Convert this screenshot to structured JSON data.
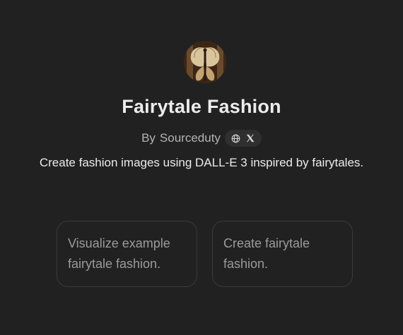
{
  "gpt": {
    "title": "Fairytale Fashion",
    "author_prefix": "By",
    "author": "Sourceduty",
    "description": "Create fashion images using DALL-E 3 inspired by fairytales.",
    "avatar_icon": "butterfly-dress-avatar",
    "social_icons": [
      "globe-icon",
      "x-logo-icon"
    ]
  },
  "conversation_starters": [
    {
      "label": "Visualize example fairytale fashion."
    },
    {
      "label": "Create fairytale fashion."
    }
  ],
  "colors": {
    "background": "#212121",
    "card_border": "#3a3a3a",
    "pill_background": "#2f2f2f",
    "muted_text": "#9b9b9b"
  }
}
